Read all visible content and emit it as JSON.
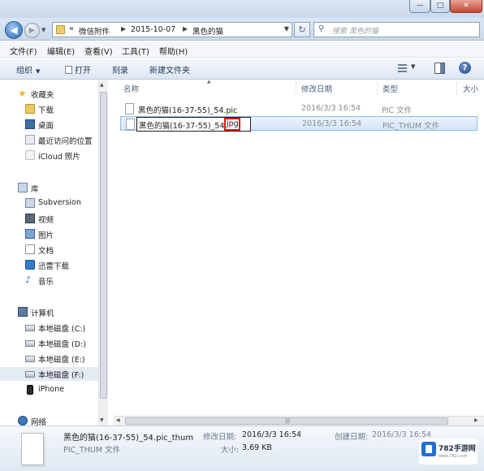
{
  "window": {
    "controls": {
      "minimize": "—",
      "maximize": "□",
      "close": "✕"
    }
  },
  "nav": {
    "back_glyph": "◀",
    "forward_glyph": "▶",
    "history_glyph": "▼",
    "breadcrumb_overflow": "«",
    "breadcrumbs": [
      "微信附件",
      "2015-10-07",
      "黑色的猫"
    ],
    "crumb_sep": "▶",
    "refresh_glyph": "↻",
    "search_placeholder": "搜索 黑色的猫"
  },
  "menu": [
    "文件(F)",
    "编辑(E)",
    "查看(V)",
    "工具(T)",
    "帮助(H)"
  ],
  "toolbar": {
    "organize": "组织",
    "open": "打开",
    "share": "刻录",
    "new_folder": "新建文件夹",
    "help_glyph": "?"
  },
  "sidebar": {
    "favorites": {
      "header": "收藏夹",
      "items": [
        "下载",
        "桌面",
        "最近访问的位置",
        "iCloud 照片"
      ]
    },
    "libraries": {
      "header": "库",
      "items": [
        "Subversion",
        "视频",
        "图片",
        "文档",
        "迅雷下载",
        "音乐"
      ]
    },
    "computer": {
      "header": "计算机",
      "items": [
        "本地磁盘 (C:)",
        "本地磁盘 (D:)",
        "本地磁盘 (E:)",
        "本地磁盘 (F:)",
        "iPhone"
      ]
    },
    "network": {
      "header": "网络"
    }
  },
  "columns": [
    "名称",
    "修改日期",
    "类型",
    "大小"
  ],
  "files": [
    {
      "name": "黑色的猫(16-37-55)_54.pic",
      "date": "2016/3/3 16:54",
      "type": "PIC 文件"
    },
    {
      "name": "黑色的猫(16-37-55)_54.pic_thum",
      "date": "2016/3/3 16:54",
      "type": "PIC_THUM 文件"
    }
  ],
  "rename": {
    "base": "黑色的猫(16-37-55)_54.",
    "ext": "jpg"
  },
  "details": {
    "filename": "黑色的猫(16-37-55)_54.pic_thum",
    "type": "PIC_THUM 文件",
    "modified_label": "修改日期:",
    "modified_value": "2016/3/3 16:54",
    "created_label": "创建日期:",
    "created_value": "2016/3/3 16:54",
    "size_label": "大小:",
    "size_value": "3.69 KB"
  },
  "watermark": {
    "text": "782手游网",
    "sub": "www.782.com"
  }
}
